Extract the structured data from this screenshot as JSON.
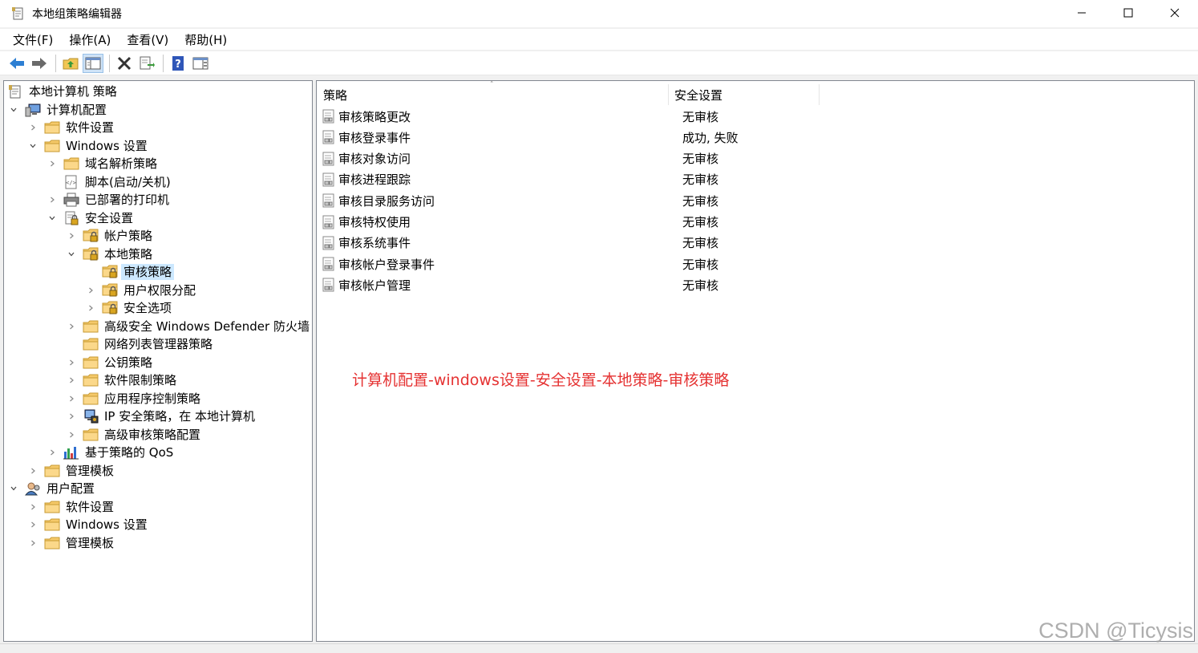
{
  "window": {
    "title": "本地组策略编辑器"
  },
  "menu": [
    {
      "label": "文件(F)"
    },
    {
      "label": "操作(A)"
    },
    {
      "label": "查看(V)"
    },
    {
      "label": "帮助(H)"
    }
  ],
  "tree": [
    {
      "label": "本地计算机 策略",
      "icon": "policy-doc-icon",
      "level": 0,
      "expander": "none"
    },
    {
      "label": "计算机配置",
      "icon": "computer-icon",
      "level": 1,
      "expander": "expanded"
    },
    {
      "label": "软件设置",
      "icon": "folder-icon",
      "level": 2,
      "expander": "collapsed"
    },
    {
      "label": "Windows 设置",
      "icon": "folder-icon",
      "level": 2,
      "expander": "expanded"
    },
    {
      "label": "域名解析策略",
      "icon": "folder-icon",
      "level": 3,
      "expander": "collapsed"
    },
    {
      "label": "脚本(启动/关机)",
      "icon": "script-icon",
      "level": 3,
      "expander": "none"
    },
    {
      "label": "已部署的打印机",
      "icon": "printer-icon",
      "level": 3,
      "expander": "collapsed"
    },
    {
      "label": "安全设置",
      "icon": "security-icon",
      "level": 3,
      "expander": "expanded"
    },
    {
      "label": "帐户策略",
      "icon": "lock-folder-icon",
      "level": 4,
      "expander": "collapsed"
    },
    {
      "label": "本地策略",
      "icon": "lock-folder-icon",
      "level": 4,
      "expander": "expanded"
    },
    {
      "label": "审核策略",
      "icon": "lock-folder-icon",
      "level": 5,
      "expander": "none",
      "selected": true
    },
    {
      "label": "用户权限分配",
      "icon": "lock-folder-icon",
      "level": 5,
      "expander": "collapsed"
    },
    {
      "label": "安全选项",
      "icon": "lock-folder-icon",
      "level": 5,
      "expander": "collapsed"
    },
    {
      "label": "高级安全 Windows Defender 防火墙",
      "icon": "folder-icon",
      "level": 4,
      "expander": "collapsed"
    },
    {
      "label": "网络列表管理器策略",
      "icon": "folder-icon",
      "level": 4,
      "expander": "none"
    },
    {
      "label": "公钥策略",
      "icon": "folder-icon",
      "level": 4,
      "expander": "collapsed"
    },
    {
      "label": "软件限制策略",
      "icon": "folder-icon",
      "level": 4,
      "expander": "collapsed"
    },
    {
      "label": "应用程序控制策略",
      "icon": "folder-icon",
      "level": 4,
      "expander": "collapsed"
    },
    {
      "label": "IP 安全策略，在 本地计算机",
      "icon": "ipsec-icon",
      "level": 4,
      "expander": "collapsed"
    },
    {
      "label": "高级审核策略配置",
      "icon": "folder-icon",
      "level": 4,
      "expander": "collapsed"
    },
    {
      "label": "基于策略的 QoS",
      "icon": "qos-chart-icon",
      "level": 3,
      "expander": "collapsed"
    },
    {
      "label": "管理模板",
      "icon": "folder-icon",
      "level": 2,
      "expander": "collapsed"
    },
    {
      "label": "用户配置",
      "icon": "user-icon",
      "level": 1,
      "expander": "expanded"
    },
    {
      "label": "软件设置",
      "icon": "folder-icon",
      "level": 2,
      "expander": "collapsed"
    },
    {
      "label": "Windows 设置",
      "icon": "folder-icon",
      "level": 2,
      "expander": "collapsed"
    },
    {
      "label": "管理模板",
      "icon": "folder-icon",
      "level": 2,
      "expander": "collapsed"
    }
  ],
  "list": {
    "columns": [
      "策略",
      "安全设置"
    ],
    "rows": [
      {
        "name": "审核策略更改",
        "value": "无审核"
      },
      {
        "name": "审核登录事件",
        "value": "成功, 失败"
      },
      {
        "name": "审核对象访问",
        "value": "无审核"
      },
      {
        "name": "审核进程跟踪",
        "value": "无审核"
      },
      {
        "name": "审核目录服务访问",
        "value": "无审核"
      },
      {
        "name": "审核特权使用",
        "value": "无审核"
      },
      {
        "name": "审核系统事件",
        "value": "无审核"
      },
      {
        "name": "审核帐户登录事件",
        "value": "无审核"
      },
      {
        "name": "审核帐户管理",
        "value": "无审核"
      }
    ]
  },
  "annotation": "计算机配置-windows设置-安全设置-本地策略-审核策略",
  "watermark": "CSDN @Ticysis",
  "colors": {
    "selection": "#cce8ff",
    "annotation": "#e53232",
    "folder": "#f5c96a"
  }
}
